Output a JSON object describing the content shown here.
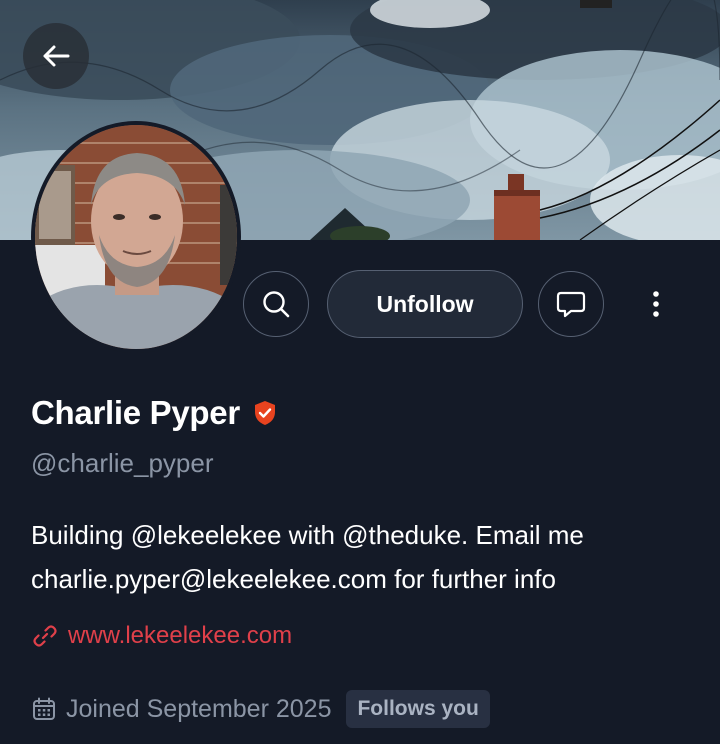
{
  "header": {
    "back_icon": "arrow-left-icon"
  },
  "actions": {
    "search_icon": "search-icon",
    "unfollow_label": "Unfollow",
    "message_icon": "chat-bubble-icon",
    "more_icon": "more-vertical-icon"
  },
  "profile": {
    "name": "Charlie Pyper",
    "verified_icon": "shield-check-icon",
    "handle": "@charlie_pyper",
    "bio_line1": "Building @lekeelekee with @theduke. Email me",
    "bio_line2": "charlie.pyper@lekeelekee.com for further info",
    "website": "www.lekeelekee.com",
    "link_icon": "link-icon",
    "joined": "Joined September 2025",
    "calendar_icon": "calendar-icon",
    "follows_you": "Follows you"
  },
  "colors": {
    "background": "#141a27",
    "accent_red": "#e0404a",
    "muted_text": "#8b95a5",
    "badge_bg": "#283042"
  }
}
